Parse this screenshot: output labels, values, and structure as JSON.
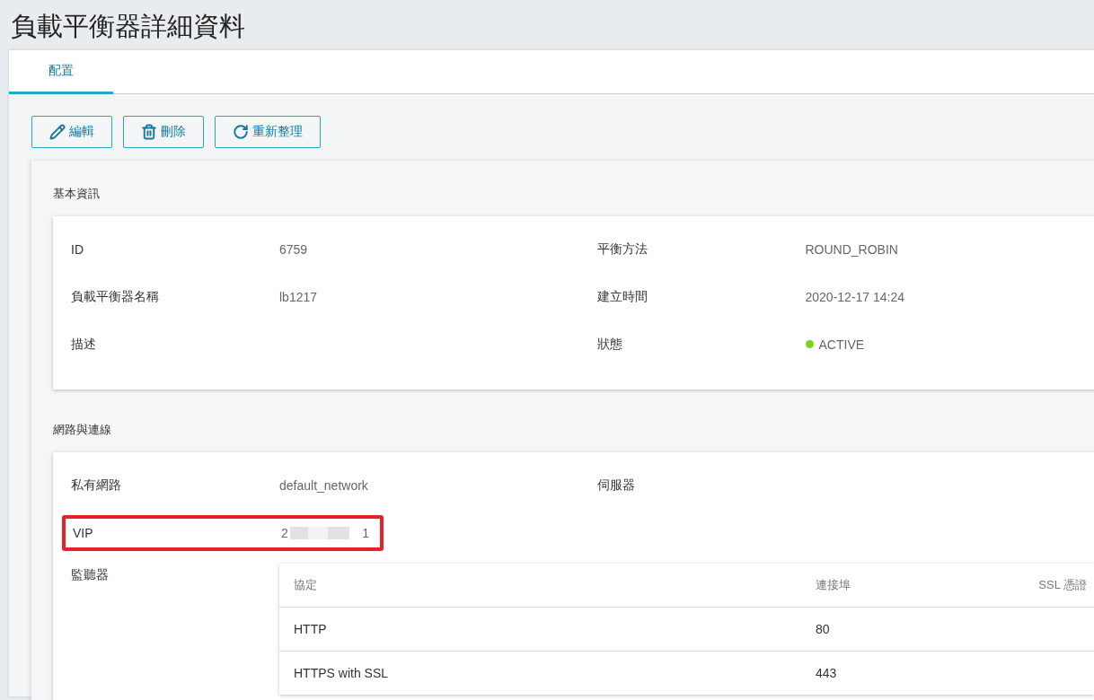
{
  "title": "負載平衡器詳細資料",
  "tabs": [
    {
      "label": "配置",
      "selected": true
    }
  ],
  "actions": [
    {
      "kind": "edit",
      "label": "編輯"
    },
    {
      "kind": "delete",
      "label": "刪除"
    },
    {
      "kind": "refresh",
      "label": "重新整理"
    }
  ],
  "basic": {
    "title": "基本資訊",
    "rows": [
      {
        "cells": [
          {
            "label": "ID",
            "value": "6759"
          },
          {
            "label": "平衡方法",
            "value": "ROUND_ROBIN"
          }
        ]
      },
      {
        "cells": [
          {
            "label": "負載平衡器名稱",
            "value": "lb1217"
          },
          {
            "label": "建立時間",
            "value": "2020-12-17 14:24"
          }
        ]
      },
      {
        "cells": [
          {
            "label": "描述"
          },
          {
            "label": "狀態",
            "kind": "status",
            "value": "ACTIVE",
            "color": "#7ed321"
          }
        ]
      }
    ]
  },
  "network": {
    "title": "網路與連線",
    "rows": [
      {
        "cells": [
          {
            "label": "私有網路",
            "value": "default_network"
          },
          {
            "label": "伺服器"
          }
        ]
      },
      {
        "cells": [
          {
            "label": "VIP",
            "kind": "redacted",
            "value_start": "2",
            "value_end": "1",
            "highlighted": true
          }
        ]
      }
    ],
    "listeners": {
      "label": "監聽器",
      "columns": [
        "協定",
        "連接埠",
        "SSL 憑證"
      ],
      "rows": [
        [
          "HTTP",
          "80"
        ],
        [
          "HTTPS with SSL",
          "443"
        ]
      ]
    }
  }
}
